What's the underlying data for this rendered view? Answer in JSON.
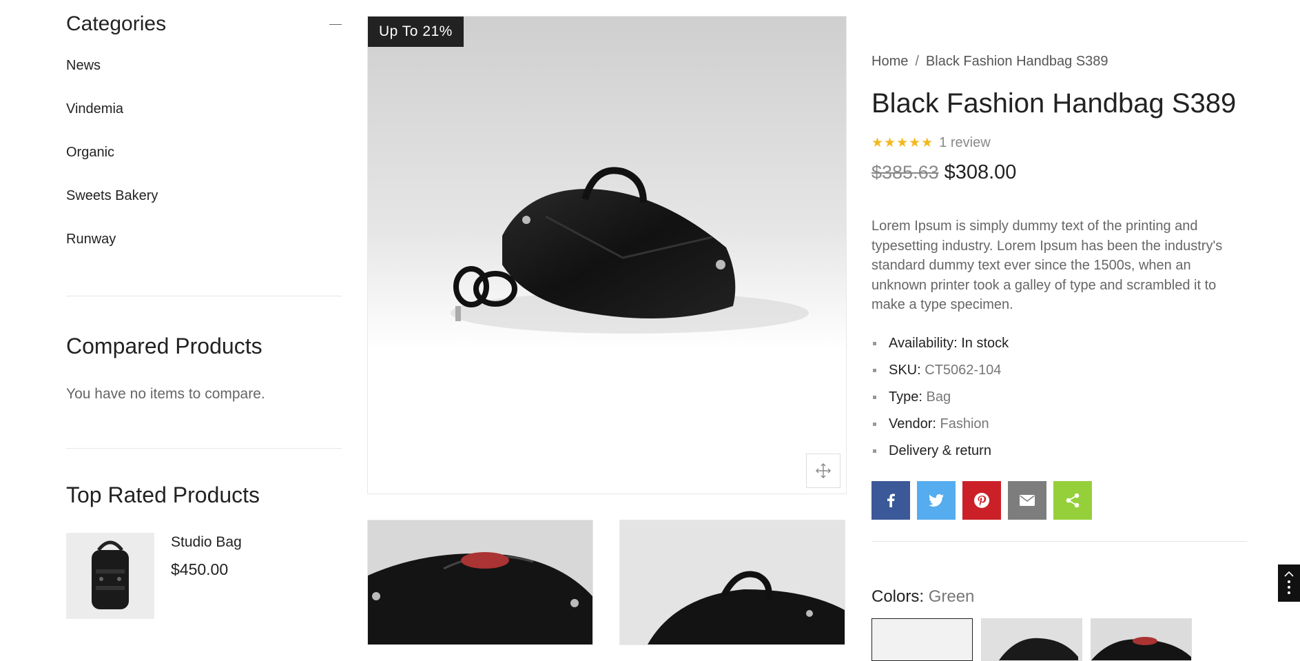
{
  "sidebar": {
    "categories": {
      "title": "Categories",
      "items": [
        "News",
        "Vindemia",
        "Organic",
        "Sweets Bakery",
        "Runway"
      ]
    },
    "compare": {
      "title": "Compared Products",
      "empty": "You have no items to compare."
    },
    "top_rated": {
      "title": "Top Rated Products",
      "items": [
        {
          "name": "Studio Bag",
          "price": "$450.00"
        }
      ]
    }
  },
  "gallery": {
    "badge": "Up To 21%",
    "icons": {
      "zoom": "move-icon"
    }
  },
  "product": {
    "breadcrumb": {
      "home": "Home",
      "sep": "/",
      "current": "Black Fashion Handbag S389"
    },
    "title": "Black Fashion Handbag S389",
    "rating": 5,
    "stars": "★★★★★",
    "reviews": "1 review",
    "old_price": "$385.63",
    "price": "$308.00",
    "description": "Lorem Ipsum is simply dummy text of the printing and typesetting industry. Lorem Ipsum has been the industry's standard dummy text ever since the 1500s, when an unknown printer took a galley of type and scrambled it to make a type specimen.",
    "meta": {
      "availability_label": "Availability:",
      "availability_value": "In stock",
      "sku_label": "SKU:",
      "sku_value": "CT5062-104",
      "type_label": "Type:",
      "type_value": "Bag",
      "vendor_label": "Vendor:",
      "vendor_value": "Fashion",
      "delivery": "Delivery & return"
    },
    "share": [
      {
        "icon": "facebook-icon",
        "color": "#3b5998"
      },
      {
        "icon": "twitter-icon",
        "color": "#55acee"
      },
      {
        "icon": "pinterest-icon",
        "color": "#cb2027"
      },
      {
        "icon": "email-icon",
        "color": "#7d7d7d"
      },
      {
        "icon": "share-icon",
        "color": "#95d03a"
      }
    ],
    "colors_label": "Colors:",
    "colors_value": "Green"
  }
}
